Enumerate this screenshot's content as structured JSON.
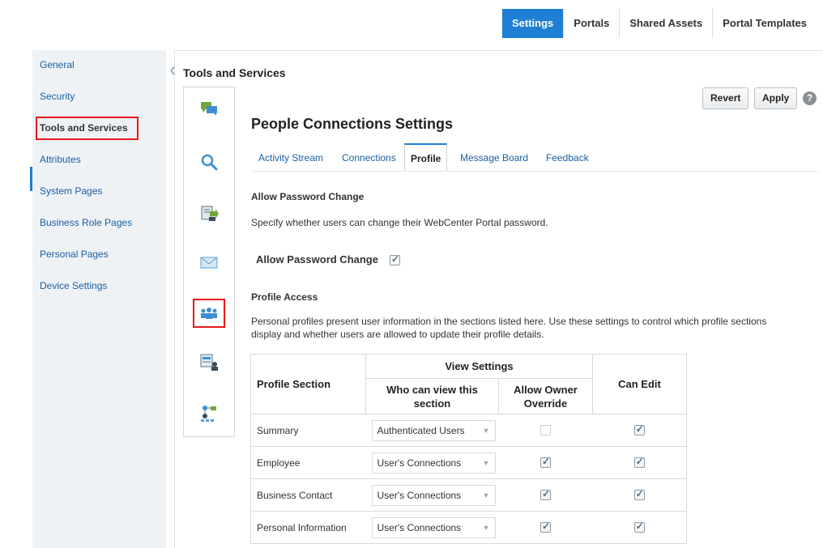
{
  "top_tabs": [
    {
      "label": "Settings",
      "active": true
    },
    {
      "label": "Portals",
      "active": false
    },
    {
      "label": "Shared Assets",
      "active": false
    },
    {
      "label": "Portal Templates",
      "active": false
    }
  ],
  "sidebar": {
    "items": [
      {
        "label": "General"
      },
      {
        "label": "Security"
      },
      {
        "label": "Tools and Services",
        "active": true
      },
      {
        "label": "Attributes"
      },
      {
        "label": "System Pages"
      },
      {
        "label": "Business Role Pages"
      },
      {
        "label": "Personal Pages"
      },
      {
        "label": "Device Settings"
      }
    ]
  },
  "panel": {
    "title": "Tools and Services",
    "rail_icons": [
      "chat-bubbles-icon",
      "search-icon",
      "document-arrow-icon",
      "mail-icon",
      "people-connections-icon",
      "document-user-icon",
      "workflow-icon"
    ]
  },
  "toolbar": {
    "revert_label": "Revert",
    "apply_label": "Apply",
    "help_glyph": "?"
  },
  "content": {
    "heading": "People Connections Settings",
    "subtabs": [
      {
        "label": "Activity Stream"
      },
      {
        "label": "Connections"
      },
      {
        "label": "Profile",
        "active": true
      },
      {
        "label": "Message Board"
      },
      {
        "label": "Feedback"
      }
    ],
    "password": {
      "heading": "Allow Password Change",
      "description": "Specify whether users can change their WebCenter Portal password.",
      "checkbox_label": "Allow Password Change",
      "checked": true
    },
    "profile_access": {
      "heading": "Profile Access",
      "description_line1": "Personal profiles present user information in the sections listed here. Use these settings to control which profile sections",
      "description_line2": "display and whether users are allowed to update their profile details."
    },
    "table": {
      "col_profile_section": "Profile Section",
      "group_view_settings": "View Settings",
      "col_who_line1": "Who can view this",
      "col_who_line2": "section",
      "col_override_line1": "Allow Owner",
      "col_override_line2": "Override",
      "col_can_edit": "Can Edit",
      "rows": [
        {
          "section": "Summary",
          "who": "Authenticated Users",
          "override": false,
          "can_edit": true
        },
        {
          "section": "Employee",
          "who": "User's Connections",
          "override": true,
          "can_edit": true
        },
        {
          "section": "Business Contact",
          "who": "User's Connections",
          "override": true,
          "can_edit": true
        },
        {
          "section": "Personal Information",
          "who": "User's Connections",
          "override": true,
          "can_edit": true
        }
      ]
    }
  },
  "colors": {
    "accent": "#1e7fd4",
    "highlight": "#e8171c",
    "link": "#1a5fa5"
  }
}
